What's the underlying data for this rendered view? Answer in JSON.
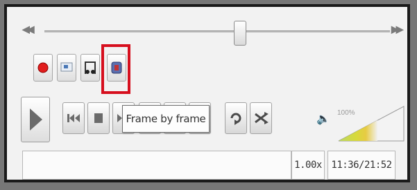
{
  "icons": {
    "rewind": "skip-back-icon",
    "forward": "skip-forward-icon",
    "record": "record-icon",
    "snapshot": "snapshot-icon",
    "loop_ab": "loop-ab-icon",
    "frame_by_frame": "frame-by-frame-icon",
    "play": "play-icon",
    "previous": "previous-icon",
    "stop": "stop-icon",
    "next": "next-icon",
    "loop": "loop-icon",
    "shuffle": "shuffle-icon",
    "volume": "speaker-icon"
  },
  "seek": {
    "position_fraction": 0.54
  },
  "tooltip": {
    "text": "Frame by frame"
  },
  "volume": {
    "label": "100%",
    "level_percent": 100
  },
  "status": {
    "speed": "1.00x",
    "time": "11:36/21:52"
  },
  "colors": {
    "highlight": "#d60f1e",
    "record": "#e11d1d"
  }
}
